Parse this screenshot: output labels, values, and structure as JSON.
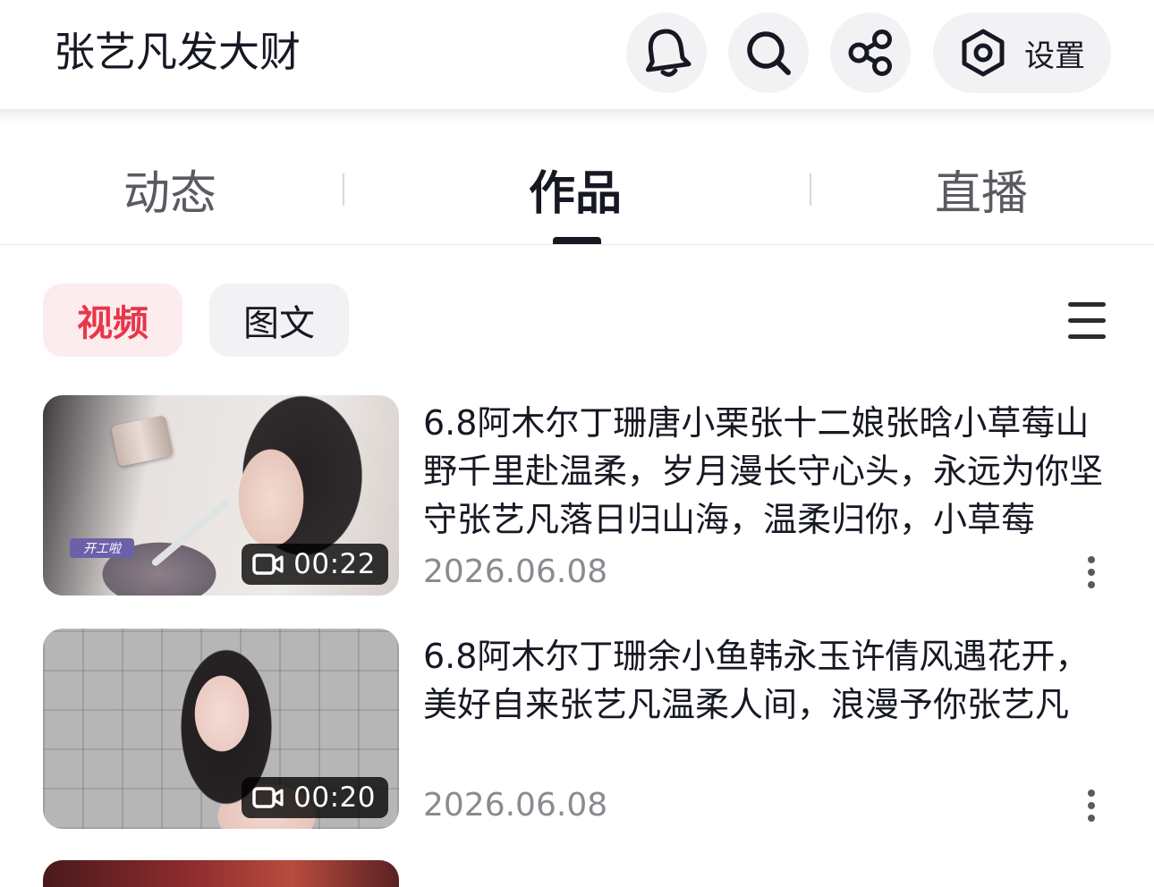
{
  "header": {
    "title": "张艺凡发大财",
    "icons": [
      "bell-icon",
      "search-icon",
      "share-icon",
      "settings-hexagon-icon"
    ],
    "settings_label": "设置"
  },
  "tabs": [
    {
      "label": "动态",
      "active": false
    },
    {
      "label": "作品",
      "active": true
    },
    {
      "label": "直播",
      "active": false
    }
  ],
  "filters": {
    "chips": [
      {
        "label": "视频",
        "active": true
      },
      {
        "label": "图文",
        "active": false
      }
    ],
    "sort_icon": "list-menu-icon"
  },
  "videos": [
    {
      "title": "6.8阿木尔丁珊唐小栗张十二娘张晗小草莓山野千里赴温柔，岁月漫长守心头，永远为你坚守张艺凡落日归山海，温柔归你，小草莓",
      "duration": "00:22",
      "date": "2026.06.08",
      "thumbnail_sticker": "开工啦"
    },
    {
      "title": "6.8阿木尔丁珊余小鱼韩永玉许倩风遇花开，美好自来张艺凡温柔人间，浪漫予你张艺凡",
      "duration": "00:20",
      "date": "2026.06.08"
    }
  ],
  "colors": {
    "accent_red": "#e8364a",
    "chip_active_bg": "#fdecee",
    "text_primary": "#161823",
    "text_secondary": "#8a8b91"
  }
}
